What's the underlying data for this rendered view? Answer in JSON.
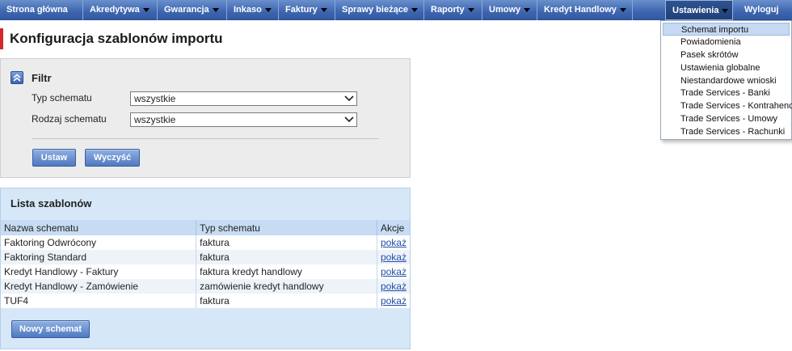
{
  "nav": {
    "items": [
      {
        "label": "Strona główna",
        "caret": false
      },
      {
        "label": "Akredytywa",
        "caret": true
      },
      {
        "label": "Gwarancja",
        "caret": true
      },
      {
        "label": "Inkaso",
        "caret": true
      },
      {
        "label": "Faktury",
        "caret": true
      },
      {
        "label": "Sprawy bieżące",
        "caret": true
      },
      {
        "label": "Raporty",
        "caret": true
      },
      {
        "label": "Umowy",
        "caret": true
      },
      {
        "label": "Kredyt Handlowy",
        "caret": true
      }
    ],
    "settings_label": "Ustawienia",
    "logout_label": "Wyloguj",
    "colors": {
      "bar": "#3e66b0",
      "active": "#1f3f78",
      "accent_red": "#d4282a"
    }
  },
  "page": {
    "title": "Konfiguracja szablonów importu"
  },
  "filter": {
    "title": "Filtr",
    "schema_type_label": "Typ schematu",
    "schema_type_value": "wszystkie",
    "schema_kind_label": "Rodzaj schematu",
    "schema_kind_value": "wszystkie",
    "apply_label": "Ustaw",
    "clear_label": "Wyczyść"
  },
  "list": {
    "title": "Lista szablonów",
    "columns": [
      "Nazwa schematu",
      "Typ schematu",
      "Akcje"
    ],
    "rows": [
      {
        "name": "Faktoring Odwrócony",
        "type": "faktura",
        "action": "pokaż"
      },
      {
        "name": "Faktoring Standard",
        "type": "faktura",
        "action": "pokaż"
      },
      {
        "name": "Kredyt Handlowy - Faktury",
        "type": "faktura kredyt handlowy",
        "action": "pokaż"
      },
      {
        "name": "Kredyt Handlowy - Zamówienie",
        "type": "zamówienie kredyt handlowy",
        "action": "pokaż"
      },
      {
        "name": "TUF4",
        "type": "faktura",
        "action": "pokaż"
      }
    ],
    "new_button_label": "Nowy schemat"
  },
  "settings_menu": {
    "items": [
      "Schemat importu",
      "Powiadomienia",
      "Pasek skrótów",
      "Ustawienia globalne",
      "Niestandardowe wnioski",
      "Trade Services - Banki",
      "Trade Services - Kontrahenci",
      "Trade Services - Umowy",
      "Trade Services - Rachunki"
    ],
    "highlighted": "Schemat importu"
  }
}
